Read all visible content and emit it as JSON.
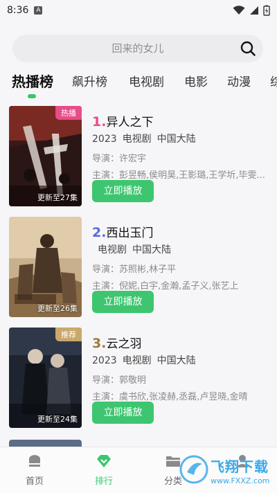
{
  "status_bar": {
    "time": "8:36",
    "sim_label": "A"
  },
  "search": {
    "placeholder": "回来的女儿"
  },
  "tabs": [
    {
      "label": "热播榜",
      "active": true
    },
    {
      "label": "飙升榜"
    },
    {
      "label": "电视剧"
    },
    {
      "label": "电影"
    },
    {
      "label": "动漫"
    },
    {
      "label": "综"
    }
  ],
  "items": [
    {
      "rank": "1.",
      "rank_color": "#e84c8b",
      "title": "异人之下",
      "year": "2023",
      "type": "电视剧",
      "region": "中国大陆",
      "director": "导演：许宏宇",
      "cast": "主演：彭昱畅,侯明昊,王影璐,王学圻,毕雯...",
      "badge": "热播",
      "badge_color": "#e84c8b",
      "episodes": "更新至27集",
      "play_label": "立即播放"
    },
    {
      "rank": "2.",
      "rank_color": "#5a6ad6",
      "title": "西出玉门",
      "year": "",
      "type": "电视剧",
      "region": "中国大陆",
      "director": "导演：苏照彬,林子平",
      "cast": "主演：倪妮,白宇,金瀚,孟子义,张艺上",
      "badge": "",
      "badge_color": "",
      "episodes": "更新至26集",
      "play_label": "立即播放"
    },
    {
      "rank": "3.",
      "rank_color": "#a07a3a",
      "title": "云之羽",
      "year": "2023",
      "type": "电视剧",
      "region": "中国大陆",
      "director": "导演：郭敬明",
      "cast": "主演：虞书欣,张凌赫,丞磊,卢昱晓,金晴",
      "badge": "推荐",
      "badge_color": "#c9a86a",
      "episodes": "更新至24集",
      "play_label": "立即播放"
    }
  ],
  "bottom_nav": [
    {
      "label": "首页",
      "icon": "home-icon"
    },
    {
      "label": "排行",
      "icon": "diamond-rank-icon",
      "active": true
    },
    {
      "label": "分类",
      "icon": "folder-icon"
    },
    {
      "label": "",
      "icon": "profile-icon"
    }
  ],
  "watermark": {
    "text": "飞翔下载",
    "url": "www.FXXZ.com"
  },
  "colors": {
    "accent": "#3dc66f",
    "background": "#f6f6f8"
  }
}
